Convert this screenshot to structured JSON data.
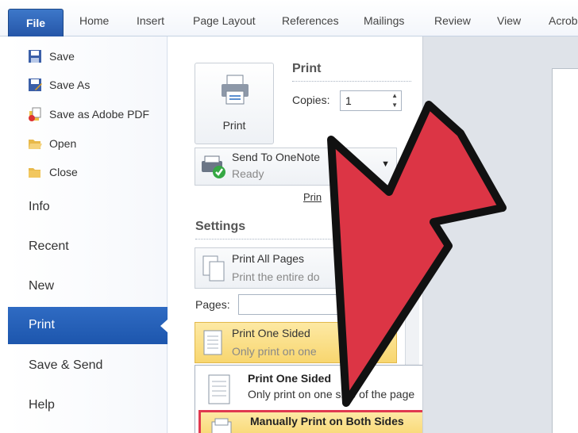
{
  "ribbon": {
    "file_tab": "File",
    "tabs": [
      "Home",
      "Insert",
      "Page Layout",
      "References",
      "Mailings",
      "Review",
      "View",
      "Acrob"
    ]
  },
  "nav": {
    "commands": [
      {
        "label": "Save",
        "icon": "save-icon"
      },
      {
        "label": "Save As",
        "icon": "save-as-icon"
      },
      {
        "label": "Save as Adobe PDF",
        "icon": "pdf-icon"
      },
      {
        "label": "Open",
        "icon": "folder-open-icon"
      },
      {
        "label": "Close",
        "icon": "folder-close-icon"
      }
    ],
    "items": [
      "Info",
      "Recent",
      "New",
      "Print",
      "Save & Send",
      "Help"
    ],
    "active": "Print"
  },
  "print": {
    "button_label": "Print",
    "section_title": "Print",
    "copies_label": "Copies:",
    "copies_value": "1"
  },
  "printer": {
    "name": "Send To OneNote",
    "status": "Ready",
    "properties_link": "Prin"
  },
  "settings": {
    "title": "Settings",
    "print_all": {
      "title": "Print All Pages",
      "subtitle": "Print the entire do"
    },
    "pages_label": "Pages:",
    "sided": {
      "title": "Print One Sided",
      "subtitle": "Only print on one"
    }
  },
  "dropdown": {
    "one_sided": {
      "title": "Print One Sided",
      "subtitle": "Only print on one side of the page"
    },
    "manual_both": {
      "title": "Manually Print on Both Sides"
    }
  },
  "colors": {
    "accent": "#2f6bc3",
    "highlight": "#f8d66f",
    "arrow_fill": "#d9303f"
  }
}
